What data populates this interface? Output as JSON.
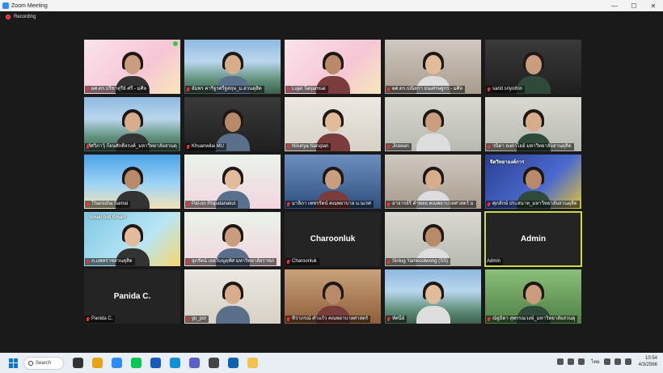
{
  "window": {
    "title": "Zoom Meeting",
    "minimize": "—",
    "maximize": "☐",
    "close": "✕"
  },
  "meeting": {
    "recording_label": "Recording"
  },
  "colors": {
    "active_speaker_border": "#c9d94a",
    "mic_muted": "#e33333",
    "recording": "#e02828"
  },
  "participants": [
    {
      "name": "ผศ.ดร.ปรีชาสุรีย์ ศรี - มศิล",
      "video": "pink",
      "muted": true,
      "status_dot": true
    },
    {
      "name": "อัมพร คาริฐรศรีฐสฤษ_ม.สวนดุสิต",
      "video": "building",
      "muted": true
    },
    {
      "name": "Lujat Tanjamsai",
      "video": "pink",
      "muted": true
    },
    {
      "name": "ผศ.ดร.ปณิสกา ธนเศรษฐกร - มศิล",
      "video": "office",
      "muted": true
    },
    {
      "name": "sarid sriyothin",
      "video": "dark",
      "muted": true
    },
    {
      "name": "ทัศวิภาวุ์ ก้อนศักดิ์จรงค์_มหาวิทยาลัยสวนดุ",
      "video": "building",
      "muted": true
    },
    {
      "name": "Khuanwilai MU",
      "video": "dark",
      "muted": true
    },
    {
      "name": "Nirunya Narupan",
      "video": "light",
      "muted": true
    },
    {
      "name": "Jirawan",
      "video": "room",
      "muted": true
    },
    {
      "name": "วนิดา ลงตาไฮอ์ มหาวิทยาลัยสวนดุสิต",
      "video": "room",
      "muted": true
    },
    {
      "name": "Thanistha Samai",
      "video": "sky",
      "muted": true
    },
    {
      "name": "Pat-on Phipatanakul",
      "video": "cartoon",
      "muted": true
    },
    {
      "name": "มาลิภา เพชรรัตน์ คณพยาบาล ม.นเรศ",
      "video": "blue",
      "muted": true
    },
    {
      "name": "อาจารย์รี คำพลย คณพยาบาลศาสตร์ ม",
      "video": "office",
      "muted": true
    },
    {
      "name": "ศุภลักษ์ ประสนาท_มหาวิทยาลัยสวนดุสิต",
      "video": "banner",
      "muted": true,
      "banner_text": "จิตวิทยาองค์การ"
    },
    {
      "name": "ภ.แพทราชสวนดุสิต",
      "video": "smallbutsmart",
      "muted": true,
      "banner_text": "Small but Smart"
    },
    {
      "name": "สุภรัตน์ เลอใบญฤทัศ มหาวิทยาลัยราชภ",
      "video": "cartoon",
      "muted": true
    },
    {
      "name": "Charoonluk",
      "video": "name",
      "display": "Charoonluk",
      "muted": true
    },
    {
      "name": "Sirilug Yamkoolwong (SS)",
      "video": "room",
      "muted": true
    },
    {
      "name": "Admin",
      "video": "name",
      "display": "Admin",
      "muted": false,
      "active": true
    },
    {
      "name": "Panida C.",
      "video": "name",
      "display": "Panida C.",
      "muted": true
    },
    {
      "name": "yp_por",
      "video": "light",
      "muted": true
    },
    {
      "name": "ทิวาภรณ์ คำแก้ว คณพยาบาลศาสตร์",
      "video": "door",
      "muted": true
    },
    {
      "name": "ทัศนีย์",
      "video": "building",
      "muted": true
    },
    {
      "name": "ณัฐธิดา สุพรรณวงษ์_มหาวิทยาลัยสวนดุ",
      "video": "outdoor",
      "muted": true
    }
  ],
  "taskbar": {
    "search_label": "Search",
    "apps": [
      "file-explorer",
      "chrome",
      "zoom",
      "line",
      "word",
      "edge",
      "teams",
      "store",
      "outlook",
      "folder"
    ],
    "tray_lang": "ไทย",
    "time": "10:54",
    "date": "4/3/2566"
  }
}
